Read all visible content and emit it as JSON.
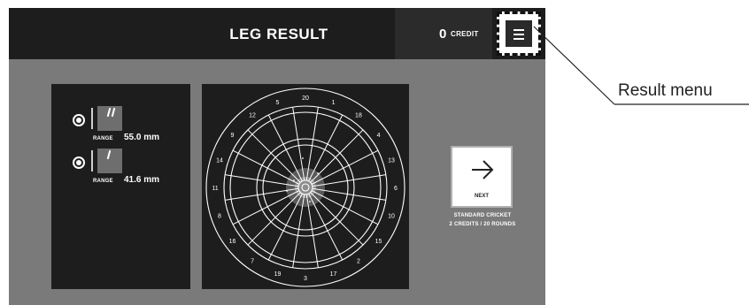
{
  "header": {
    "title": "LEG RESULT",
    "credit_count": "0",
    "credit_label": "CREDIT"
  },
  "throws": [
    {
      "range_label": "RANGE",
      "range_value": "55.0 mm"
    },
    {
      "range_label": "RANGE",
      "range_value": "41.6 mm"
    }
  ],
  "dartboard": {
    "numbers": [
      "20",
      "1",
      "18",
      "4",
      "13",
      "6",
      "10",
      "15",
      "2",
      "17",
      "3",
      "19",
      "7",
      "16",
      "8",
      "11",
      "14",
      "9",
      "12",
      "5"
    ]
  },
  "next": {
    "label": "NEXT",
    "game_name": "STANDARD CRICKET",
    "game_detail": "2 CREDITS / 20 ROUNDS"
  },
  "callout": {
    "label": "Result menu"
  },
  "colors": {
    "background": "#7a7a7a",
    "panel": "#1d1d1d",
    "header": "#1d1d1d",
    "text": "#ffffff"
  },
  "icons": {
    "menu": "hamburger-menu-icon",
    "next": "arrow-right-icon",
    "radio": "radio-selected-icon"
  }
}
